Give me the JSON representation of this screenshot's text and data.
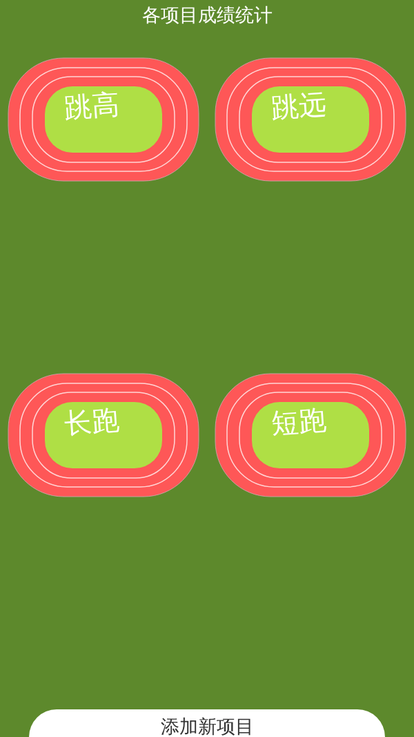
{
  "title": "各项目成绩统计",
  "events": [
    {
      "label": "跳高"
    },
    {
      "label": "跳远"
    },
    {
      "label": "长跑"
    },
    {
      "label": "短跑"
    }
  ],
  "add_button": {
    "label": "添加新项目"
  }
}
